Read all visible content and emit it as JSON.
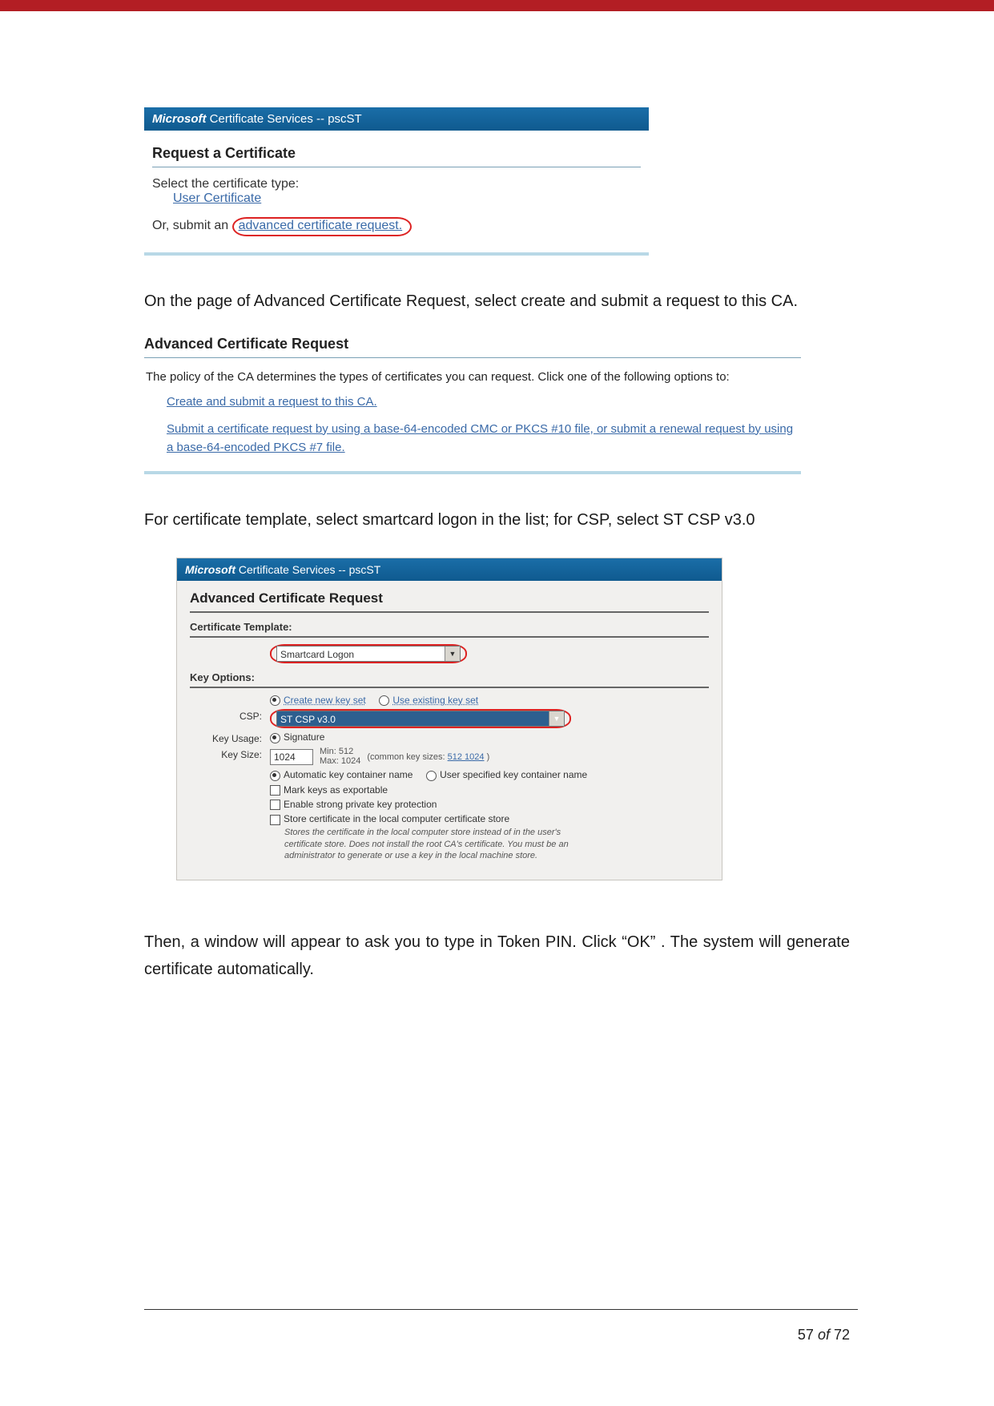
{
  "banner": {
    "brand": "Microsoft",
    "suffix": " Certificate Services  --  pscST"
  },
  "shot1": {
    "title": "Request a Certificate",
    "selectLabel": "Select the certificate type:",
    "userCertLink": "User Certificate",
    "orSubmitPrefix": "Or, submit an ",
    "advReqLink": "advanced certificate request.",
    "orSubmitSuffix": ""
  },
  "para1": "On the page of Advanced Certificate Request, select create and submit a request to this CA.",
  "shot2": {
    "title": "Advanced Certificate Request",
    "policy": "The policy of the CA determines the types of certificates you can request. Click one of the following options to:",
    "link1": "Create and submit a request to this CA.",
    "link2": "Submit a certificate request by using a base-64-encoded CMC or PKCS #10 file, or submit a renewal request by using a base-64-encoded PKCS #7 file."
  },
  "para2": "For certificate template, select smartcard logon in the list; for CSP, select ST CSP v3.0",
  "shot3": {
    "title": "Advanced Certificate Request",
    "secTemplate": "Certificate Template:",
    "templateValue": "Smartcard Logon",
    "secKeyOptions": "Key Options:",
    "radioCreate": "Create new key set",
    "radioUseExisting": "Use existing key set",
    "cspLabel": "CSP:",
    "cspValue": "ST CSP v3.0",
    "keyUsageLabel": "Key Usage:",
    "keyUsageValue": "Signature",
    "keySizeLabel": "Key Size:",
    "keySizeValue": "1024",
    "keySizeMin": "Min:  512",
    "keySizeMax": "Max: 1024",
    "keySizeCommonPrefix": "(common key sizes: ",
    "keySizeCommon": "512 1024",
    "keySizeCommonSuffix": " )",
    "radioAutoName": "Automatic key container name",
    "radioUserName": "User specified key container name",
    "chkExportable": "Mark keys as exportable",
    "chkStrong": "Enable strong private key protection",
    "chkStoreLocal": "Store certificate in the local computer certificate store",
    "storeLocalNote": "Stores the certificate in the local computer store instead of in the user's certificate store. Does not install the root CA's certificate. You must be an administrator to generate or use a key in the local machine store."
  },
  "para3": "Then, a window will appear to ask you to type in Token PIN. Click “OK” . The system will generate certificate automatically.",
  "footer": {
    "page": "57",
    "of": "of",
    "total": "72"
  }
}
